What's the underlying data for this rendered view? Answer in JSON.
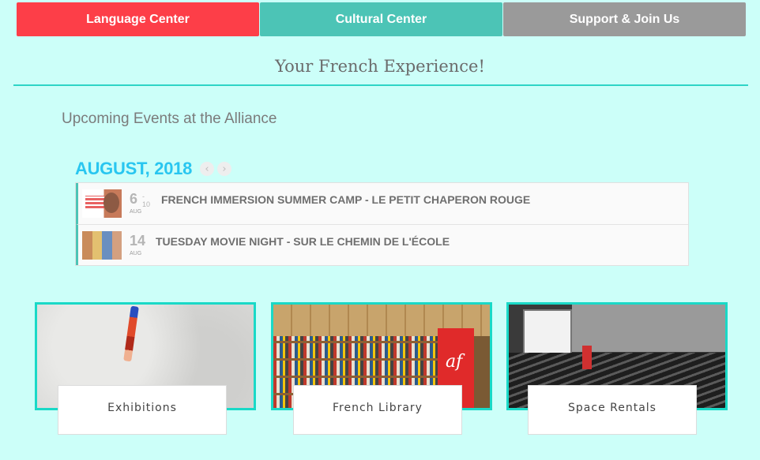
{
  "nav": {
    "language_center": "Language Center",
    "cultural_center": "Cultural Center",
    "support_join": "Support & Join Us"
  },
  "page_title": "Your French Experience!",
  "upcoming_heading": "Upcoming Events at the Alliance",
  "calendar": {
    "month_label": "AUGUST, 2018",
    "prev_icon": "chevron-left-icon",
    "next_icon": "chevron-right-icon",
    "prev_glyph": "‹",
    "next_glyph": "›",
    "events": [
      {
        "day": "6",
        "range": "- 10",
        "month": "AUG",
        "title": "FRENCH IMMERSION SUMMER CAMP - LE PETIT CHAPERON ROUGE"
      },
      {
        "day": "14",
        "range": "",
        "month": "AUG",
        "title": "TUESDAY MOVIE NIGHT - SUR LE CHEMIN DE L'ÉCOLE"
      }
    ]
  },
  "cards": {
    "exhibitions": "Exhibitions",
    "library": "French Library",
    "library_logo": "af",
    "rentals": "Space Rentals"
  },
  "colors": {
    "background": "#ccfff9",
    "language_tab": "#fd3e48",
    "cultural_tab": "#4cc4b6",
    "support_tab": "#9a9a9a",
    "month_label": "#29c6f0",
    "accent_border": "#19d9c7"
  }
}
